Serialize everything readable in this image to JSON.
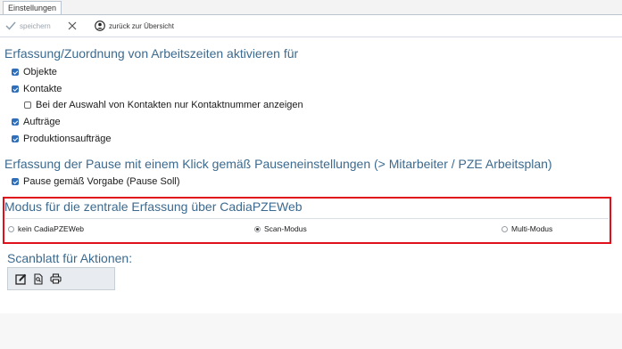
{
  "tabs": [
    {
      "label": "Einstellungen"
    }
  ],
  "toolbar": {
    "save_label": "speichern",
    "back_label": "zurück zur Übersicht",
    "icons": {
      "save": "checkmark-icon",
      "cancel": "close-icon",
      "back": "user-circle-icon"
    }
  },
  "section_times": {
    "title": "Erfassung/Zuordnung von Arbeitszeiten aktivieren für",
    "items": [
      {
        "label": "Objekte",
        "checked": true
      },
      {
        "label": "Kontakte",
        "checked": true
      },
      {
        "label": "Bei der Auswahl von Kontakten nur Kontaktnummer anzeigen",
        "checked": false
      },
      {
        "label": "Aufträge",
        "checked": true
      },
      {
        "label": "Produktionsaufträge",
        "checked": true
      }
    ]
  },
  "section_pause": {
    "title": "Erfassung der Pause mit einem Klick gemäß Pauseneinstellungen (> Mitarbeiter / PZE Arbeitsplan)",
    "items": [
      {
        "label": "Pause gemäß Vorgabe (Pause Soll)",
        "checked": true
      }
    ]
  },
  "section_mode": {
    "title": "Modus für die zentrale Erfassung über CadiaPZEWeb",
    "options": [
      {
        "label": "kein CadiaPZEWeb",
        "selected": false
      },
      {
        "label": "Scan-Modus",
        "selected": true
      },
      {
        "label": "Multi-Modus",
        "selected": false
      }
    ],
    "highlight_color": "#e0101a"
  },
  "section_scan": {
    "title": "Scanblatt für Aktionen:",
    "buttons": [
      {
        "icon": "edit-icon"
      },
      {
        "icon": "document-search-icon"
      },
      {
        "icon": "print-icon"
      }
    ]
  },
  "colors": {
    "section_title": "#3c6a8f",
    "checkbox": "#2f6fba"
  }
}
